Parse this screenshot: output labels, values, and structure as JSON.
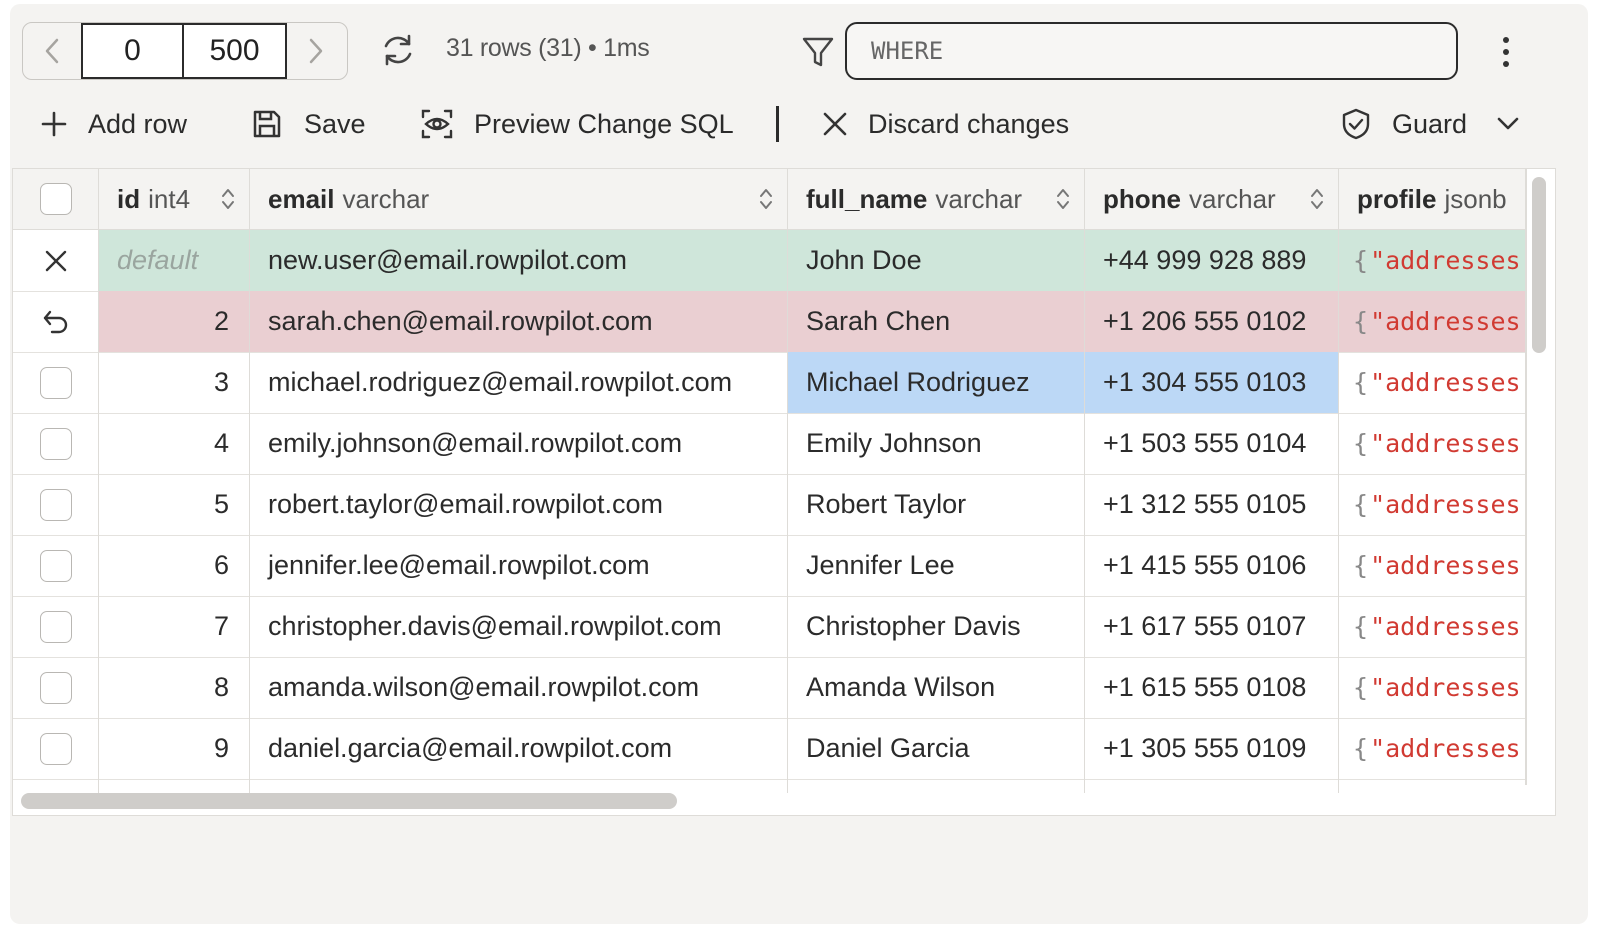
{
  "pagination": {
    "offset": "0",
    "limit": "500"
  },
  "query_status": "31 rows (31) • 1ms",
  "filter": {
    "placeholder": "WHERE"
  },
  "actions": {
    "add_row": "Add row",
    "save": "Save",
    "preview": "Preview Change SQL",
    "discard": "Discard changes",
    "guard": "Guard"
  },
  "columns": [
    {
      "name": "id",
      "type": "int4"
    },
    {
      "name": "email",
      "type": "varchar"
    },
    {
      "name": "full_name",
      "type": "varchar"
    },
    {
      "name": "phone",
      "type": "varchar"
    },
    {
      "name": "profile",
      "type": "jsonb"
    }
  ],
  "rows": [
    {
      "id": "default",
      "email": "new.user@email.rowpilot.com",
      "full_name": "John Doe",
      "phone": "+44 999 928 889",
      "profile": "\"addresses"
    },
    {
      "id": "2",
      "email": "sarah.chen@email.rowpilot.com",
      "full_name": "Sarah Chen",
      "phone": "+1 206 555 0102",
      "profile": "\"addresses"
    },
    {
      "id": "3",
      "email": "michael.rodriguez@email.rowpilot.com",
      "full_name": "Michael Rodriguez",
      "phone": "+1 304 555 0103",
      "profile": "\"addresses"
    },
    {
      "id": "4",
      "email": "emily.johnson@email.rowpilot.com",
      "full_name": "Emily Johnson",
      "phone": "+1 503 555 0104",
      "profile": "\"addresses"
    },
    {
      "id": "5",
      "email": "robert.taylor@email.rowpilot.com",
      "full_name": "Robert Taylor",
      "phone": "+1 312 555 0105",
      "profile": "\"addresses"
    },
    {
      "id": "6",
      "email": "jennifer.lee@email.rowpilot.com",
      "full_name": "Jennifer Lee",
      "phone": "+1 415 555 0106",
      "profile": "\"addresses"
    },
    {
      "id": "7",
      "email": "christopher.davis@email.rowpilot.com",
      "full_name": "Christopher Davis",
      "phone": "+1 617 555 0107",
      "profile": "\"addresses"
    },
    {
      "id": "8",
      "email": "amanda.wilson@email.rowpilot.com",
      "full_name": "Amanda Wilson",
      "phone": "+1 615 555 0108",
      "profile": "\"addresses"
    },
    {
      "id": "9",
      "email": "daniel.garcia@email.rowpilot.com",
      "full_name": "Daniel Garcia",
      "phone": "+1 305 555 0109",
      "profile": "\"addresses"
    }
  ],
  "colors": {
    "new_row": "#cfe6da",
    "deleted_row": "#eacfd2",
    "selected_cell": "#bcd8f6",
    "json_string": "#d13a32"
  }
}
